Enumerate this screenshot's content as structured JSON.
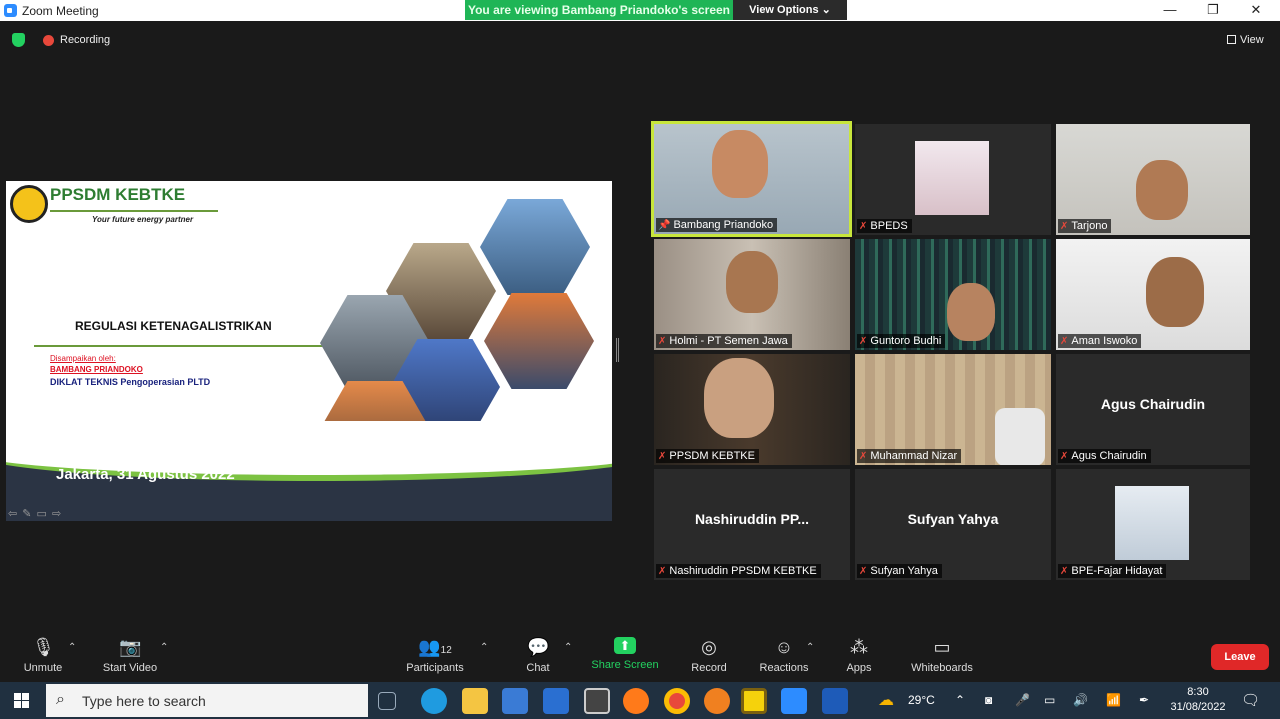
{
  "window": {
    "title": "Zoom Meeting",
    "banner_text": "You are viewing Bambang Priandoko's screen",
    "view_options_label": "View Options ⌄",
    "controls": [
      "—",
      "❐",
      "✕"
    ]
  },
  "topbar": {
    "recording_label": "Recording",
    "view_label": "View"
  },
  "slide": {
    "brand": "PPSDM KEBTKE",
    "tagline": "Your future energy partner",
    "subject": "REGULASI KETENAGALISTRIKAN",
    "presented_by_label": "Disampaikan oleh:",
    "presenter": "BAMBANG PRIANDOKO",
    "course": "DIKLAT TEKNIS Pengoperasian PLTD",
    "date": "Jakarta, 31 Agustus 2022"
  },
  "participants": [
    {
      "name": "Bambang Priandoko",
      "big_name": "",
      "active": true,
      "pinned": true
    },
    {
      "name": "BPEDS",
      "big_name": ""
    },
    {
      "name": "Tarjono",
      "big_name": ""
    },
    {
      "name": "Holmi - PT Semen Jawa",
      "big_name": ""
    },
    {
      "name": "Guntoro Budhi",
      "big_name": ""
    },
    {
      "name": "Aman Iswoko",
      "big_name": ""
    },
    {
      "name": "PPSDM KEBTKE",
      "big_name": ""
    },
    {
      "name": "Muhammad Nizar",
      "big_name": ""
    },
    {
      "name": "Agus Chairudin",
      "big_name": "Agus Chairudin"
    },
    {
      "name": "Nashiruddin PPSDM KEBTKE",
      "big_name": "Nashiruddin PP..."
    },
    {
      "name": "Sufyan Yahya",
      "big_name": "Sufyan Yahya"
    },
    {
      "name": "BPE-Fajar Hidayat",
      "big_name": ""
    }
  ],
  "toolbar": {
    "unmute": "Unmute",
    "start_video": "Start Video",
    "participants": "Participants",
    "participants_count": "12",
    "chat": "Chat",
    "share_screen": "Share Screen",
    "record": "Record",
    "reactions": "Reactions",
    "apps": "Apps",
    "whiteboards": "Whiteboards",
    "leave": "Leave"
  },
  "taskbar": {
    "search_placeholder": "Type here to search",
    "temperature": "29°C",
    "time": "8:30",
    "date": "31/08/2022"
  },
  "colors": {
    "accent_green": "#23d160",
    "active_speaker": "#c8e63c",
    "leave_red": "#e02828"
  }
}
